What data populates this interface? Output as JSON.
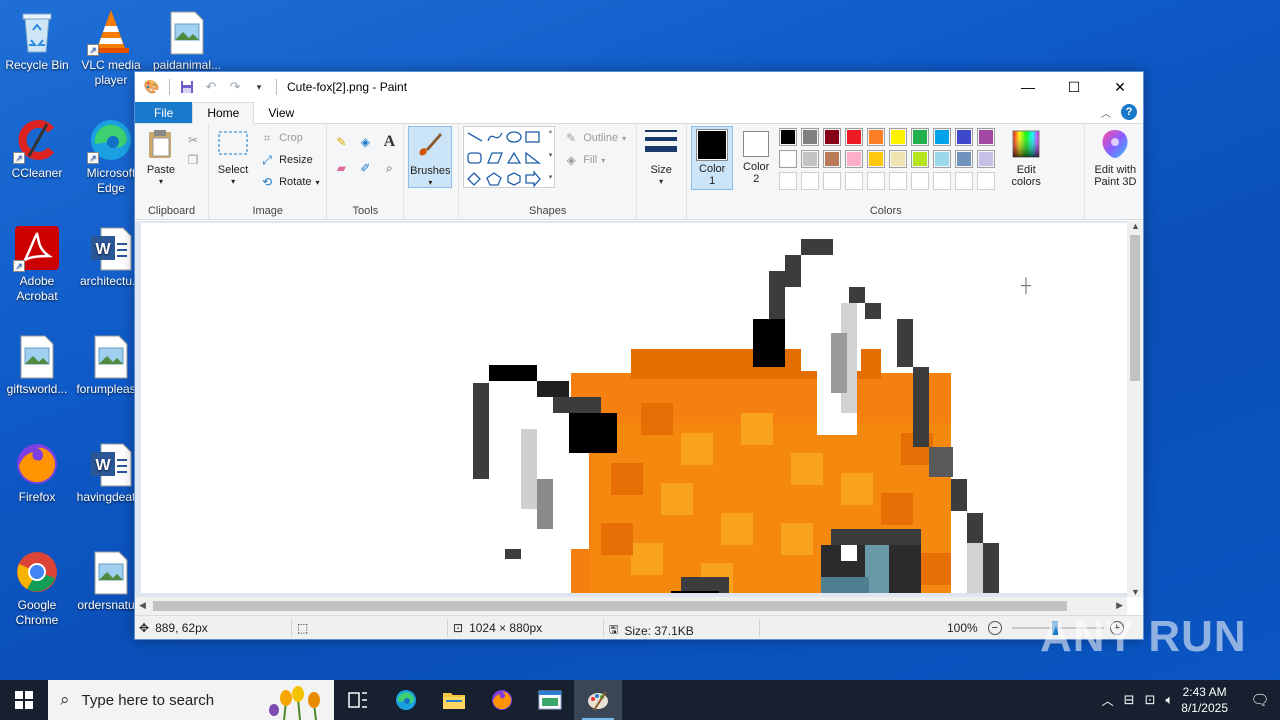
{
  "desktop": {
    "icons": [
      {
        "label": "Recycle Bin"
      },
      {
        "label": "VLC media player"
      },
      {
        "label": "paidanimal..."
      },
      {
        "label": "CCleaner"
      },
      {
        "label": "Microsoft Edge"
      },
      {
        "label": "Adobe Acrobat"
      },
      {
        "label": "architectu..."
      },
      {
        "label": "giftsworld..."
      },
      {
        "label": "forumpleas..."
      },
      {
        "label": "Firefox"
      },
      {
        "label": "havingdeat..."
      },
      {
        "label": "Google Chrome"
      },
      {
        "label": "ordersnatu..."
      }
    ]
  },
  "paint": {
    "title": "Cute-fox[2].png - Paint",
    "tabs": {
      "file": "File",
      "home": "Home",
      "view": "View"
    },
    "ribbon": {
      "clipboard": {
        "paste": "Paste",
        "label": "Clipboard"
      },
      "image": {
        "select": "Select",
        "crop": "Crop",
        "resize": "Resize",
        "rotate": "Rotate",
        "label": "Image"
      },
      "tools": {
        "label": "Tools"
      },
      "brushes": {
        "label": "Brushes"
      },
      "shapes": {
        "outline": "Outline",
        "fill": "Fill",
        "label": "Shapes"
      },
      "size": {
        "label": "Size"
      },
      "colors": {
        "color1": "Color\n1",
        "color2": "Color\n2",
        "edit_colors": "Edit colors",
        "label": "Colors",
        "color1_value": "#000000",
        "color2_value": "#ffffff",
        "palette": [
          "#000000",
          "#7f7f7f",
          "#880015",
          "#ed1c24",
          "#ff7f27",
          "#fff200",
          "#22b14c",
          "#00a2e8",
          "#3f48cc",
          "#a349a4",
          "#ffffff",
          "#c3c3c3",
          "#b97a57",
          "#ffaec9",
          "#ffc90e",
          "#efe4b0",
          "#b5e61d",
          "#99d9ea",
          "#7092be",
          "#c8bfe7"
        ]
      },
      "paint3d": {
        "label": "Edit with Paint 3D"
      }
    },
    "status": {
      "cursor": "889, 62px",
      "dimensions": "1024 × 880px",
      "size": "Size: 37.1KB",
      "zoom": "100%"
    }
  },
  "taskbar": {
    "search_placeholder": "Type here to search",
    "time": "2:43 AM",
    "date": "8/1/2025"
  },
  "watermark": "ANY RUN"
}
